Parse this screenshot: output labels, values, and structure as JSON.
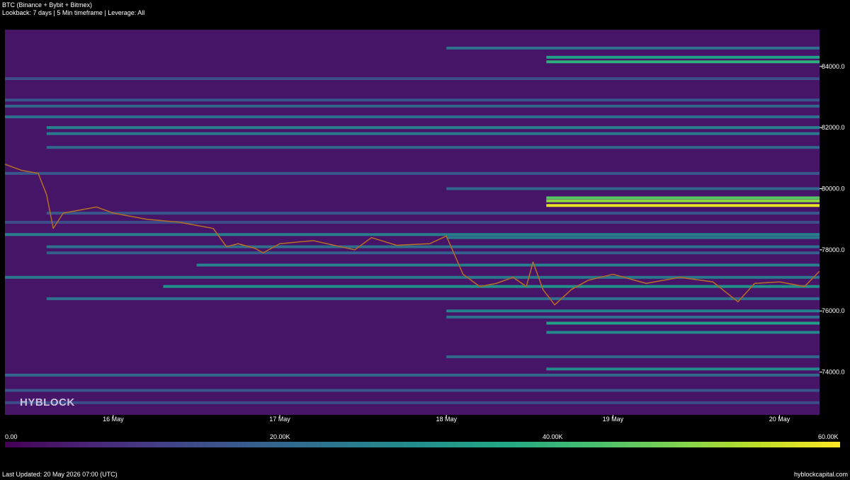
{
  "header": {
    "title": "BTC (Binance + Bybit + Bitmex)",
    "subtitle": "Lookback: 7 days | 5 Min timeframe | Leverage: All"
  },
  "watermark": "HYBLOCK",
  "footer": {
    "last_updated": "Last Updated: 20 May 2026 07:00 (UTC)",
    "site": "hyblockcapital.com"
  },
  "colorbar": {
    "labels": [
      "0.00",
      "20.00K",
      "40.00K",
      "60.00K"
    ],
    "values": [
      0,
      20000,
      40000,
      60000
    ],
    "colormap": [
      "#440154",
      "#482475",
      "#414487",
      "#355f8d",
      "#2a788e",
      "#21918c",
      "#22a884",
      "#44bf70",
      "#7ad151",
      "#bddf26",
      "#fde725"
    ]
  },
  "chart_data": {
    "type": "heatmap",
    "title": "BTC (Binance + Bybit + Bitmex)",
    "x_tick_labels": [
      "16 May",
      "17 May",
      "18 May",
      "19 May",
      "20 May"
    ],
    "x_tick_days": [
      16,
      17,
      18,
      19,
      20
    ],
    "xlim": [
      15.35,
      20.24
    ],
    "y_tick_labels": [
      "74000.0",
      "76000.0",
      "78000.0",
      "80000.0",
      "82000.0",
      "84000.0"
    ],
    "y_ticks": [
      74000,
      76000,
      78000,
      80000,
      82000,
      84000
    ],
    "ylim": [
      72600,
      85200
    ],
    "value_range": [
      0,
      60000
    ],
    "price_series": {
      "name": "BTC price",
      "x": [
        15.35,
        15.45,
        15.55,
        15.6,
        15.64,
        15.7,
        15.8,
        15.9,
        16.0,
        16.2,
        16.4,
        16.6,
        16.68,
        16.75,
        16.85,
        16.9,
        17.0,
        17.2,
        17.45,
        17.55,
        17.7,
        17.9,
        18.0,
        18.1,
        18.2,
        18.3,
        18.4,
        18.48,
        18.52,
        18.58,
        18.65,
        18.75,
        18.85,
        19.0,
        19.2,
        19.4,
        19.6,
        19.75,
        19.85,
        20.0,
        20.15,
        20.24
      ],
      "y": [
        80800,
        80600,
        80500,
        79800,
        78700,
        79200,
        79300,
        79400,
        79200,
        79000,
        78900,
        78700,
        78100,
        78200,
        78050,
        77900,
        78200,
        78300,
        78000,
        78400,
        78150,
        78200,
        78450,
        77200,
        76800,
        76900,
        77100,
        76800,
        77600,
        76700,
        76200,
        76700,
        77000,
        77200,
        76900,
        77100,
        76950,
        76300,
        76900,
        76950,
        76800,
        77300
      ]
    },
    "liquidation_levels": [
      {
        "price": 84600,
        "start_day": 18.0,
        "value": 22000
      },
      {
        "price": 84300,
        "start_day": 18.6,
        "value": 34000
      },
      {
        "price": 84150,
        "start_day": 18.6,
        "value": 38000
      },
      {
        "price": 83600,
        "start_day": 15.35,
        "value": 14000
      },
      {
        "price": 82900,
        "start_day": 15.35,
        "value": 16000
      },
      {
        "price": 82700,
        "start_day": 15.35,
        "value": 20000
      },
      {
        "price": 82350,
        "start_day": 15.35,
        "value": 22000
      },
      {
        "price": 82000,
        "start_day": 15.6,
        "value": 26000
      },
      {
        "price": 81800,
        "start_day": 15.6,
        "value": 24000
      },
      {
        "price": 81350,
        "start_day": 15.6,
        "value": 20000
      },
      {
        "price": 80500,
        "start_day": 15.35,
        "value": 16000
      },
      {
        "price": 80000,
        "start_day": 18.0,
        "value": 20000
      },
      {
        "price": 79700,
        "start_day": 18.6,
        "value": 44000
      },
      {
        "price": 79600,
        "start_day": 18.6,
        "value": 50000
      },
      {
        "price": 79450,
        "start_day": 18.6,
        "value": 58000
      },
      {
        "price": 79200,
        "start_day": 15.6,
        "value": 16000
      },
      {
        "price": 78900,
        "start_day": 15.35,
        "value": 14000
      },
      {
        "price": 78500,
        "start_day": 15.35,
        "value": 26000
      },
      {
        "price": 78400,
        "start_day": 18.0,
        "value": 24000
      },
      {
        "price": 78100,
        "start_day": 15.6,
        "value": 22000
      },
      {
        "price": 77900,
        "start_day": 15.6,
        "value": 18000
      },
      {
        "price": 77500,
        "start_day": 16.5,
        "value": 26000
      },
      {
        "price": 77100,
        "start_day": 15.35,
        "value": 24000
      },
      {
        "price": 76800,
        "start_day": 16.3,
        "value": 30000
      },
      {
        "price": 76400,
        "start_day": 15.6,
        "value": 22000
      },
      {
        "price": 76000,
        "start_day": 18.0,
        "value": 26000
      },
      {
        "price": 75800,
        "start_day": 18.0,
        "value": 22000
      },
      {
        "price": 75600,
        "start_day": 18.6,
        "value": 34000
      },
      {
        "price": 75300,
        "start_day": 18.6,
        "value": 28000
      },
      {
        "price": 74500,
        "start_day": 18.0,
        "value": 20000
      },
      {
        "price": 74100,
        "start_day": 18.6,
        "value": 28000
      },
      {
        "price": 73900,
        "start_day": 15.35,
        "value": 20000
      },
      {
        "price": 73400,
        "start_day": 15.35,
        "value": 16000
      },
      {
        "price": 73000,
        "start_day": 15.35,
        "value": 14000
      }
    ],
    "grid": false,
    "legend": "colorbar-bottom"
  }
}
